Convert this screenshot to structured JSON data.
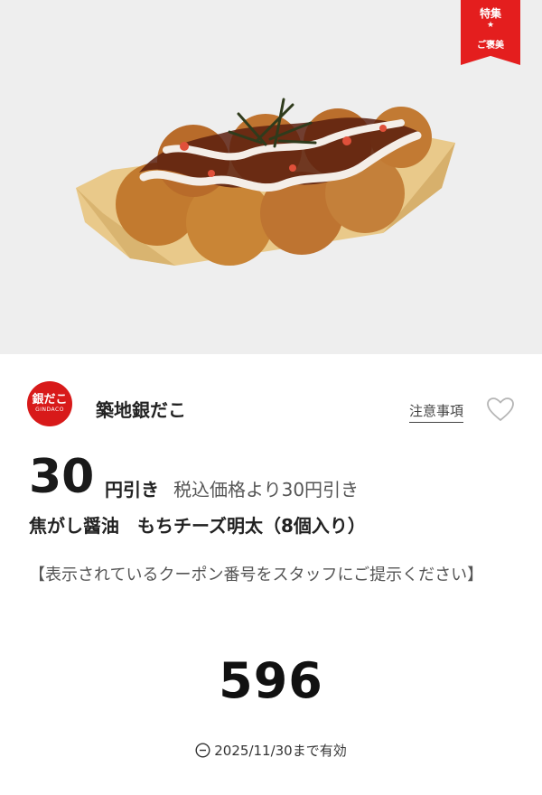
{
  "badge": {
    "line1": "特集",
    "star": "★",
    "line2": "ご褒美"
  },
  "hero": {
    "image": "takoyaki-plate-image"
  },
  "logo": {
    "text_main": "銀だこ",
    "text_sub": "GINDACO"
  },
  "brand": {
    "name": "築地銀だこ"
  },
  "actions": {
    "notes_label": "注意事項",
    "favorite_icon": "heart-outline-icon"
  },
  "discount": {
    "amount": "30",
    "unit": "円引き",
    "detail": "税込価格より30円引き"
  },
  "product": {
    "name": "焦がし醤油　もちチーズ明太（8個入り）"
  },
  "instruction": "【表示されているクーポン番号をスタッフにご提示ください】",
  "coupon": {
    "code": "596"
  },
  "expiry": {
    "icon": "clock-minus-icon",
    "text": "2025/11/30まで有効"
  },
  "colors": {
    "accent": "#e41e1e",
    "hero_bg": "#eeeeee",
    "text": "#222222"
  }
}
